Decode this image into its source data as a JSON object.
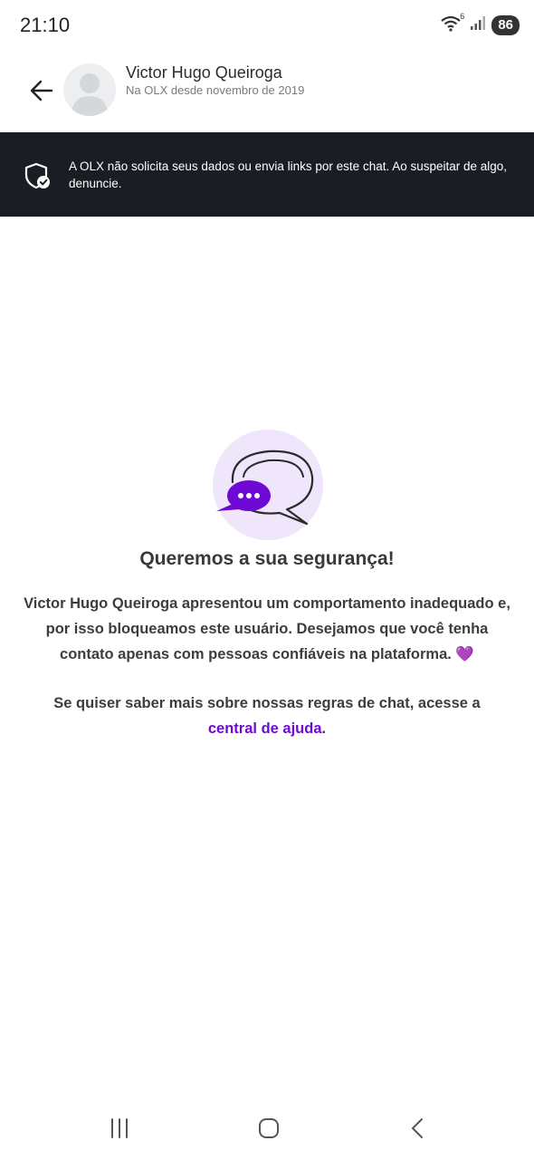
{
  "status_bar": {
    "time": "21:10",
    "wifi_badge": "6",
    "battery": "86",
    "icons": [
      "wifi-icon",
      "signal-icon"
    ]
  },
  "header": {
    "back_icon": "arrow-left-icon",
    "contact_name": "Victor Hugo Queiroga",
    "contact_subtitle": "Na OLX desde novembro de 2019"
  },
  "banner": {
    "icon": "shield-check-icon",
    "text": "A OLX não solicita seus dados ou envia links por este chat. Ao suspeitar de algo, denuncie."
  },
  "empty_state": {
    "illustration_icon": "chat-bubbles-icon",
    "headline": "Queremos a sua segurança!",
    "message": "Victor Hugo Queiroga apresentou um comportamento inadequado e, por isso bloqueamos este usuário. Desejamos que você tenha contato apenas com pessoas confiáveis na plataforma. 💜",
    "help_prefix": "Se quiser saber mais sobre nossas regras de chat, acesse a",
    "help_link": "central de ajuda",
    "help_suffix": "."
  },
  "nav_bar": {
    "icons": [
      "recent-apps-icon",
      "home-icon",
      "back-icon"
    ]
  },
  "colors": {
    "banner_bg": "#1a1d23",
    "accent": "#6e0ad6",
    "illustration_bg": "#efe6fb"
  }
}
